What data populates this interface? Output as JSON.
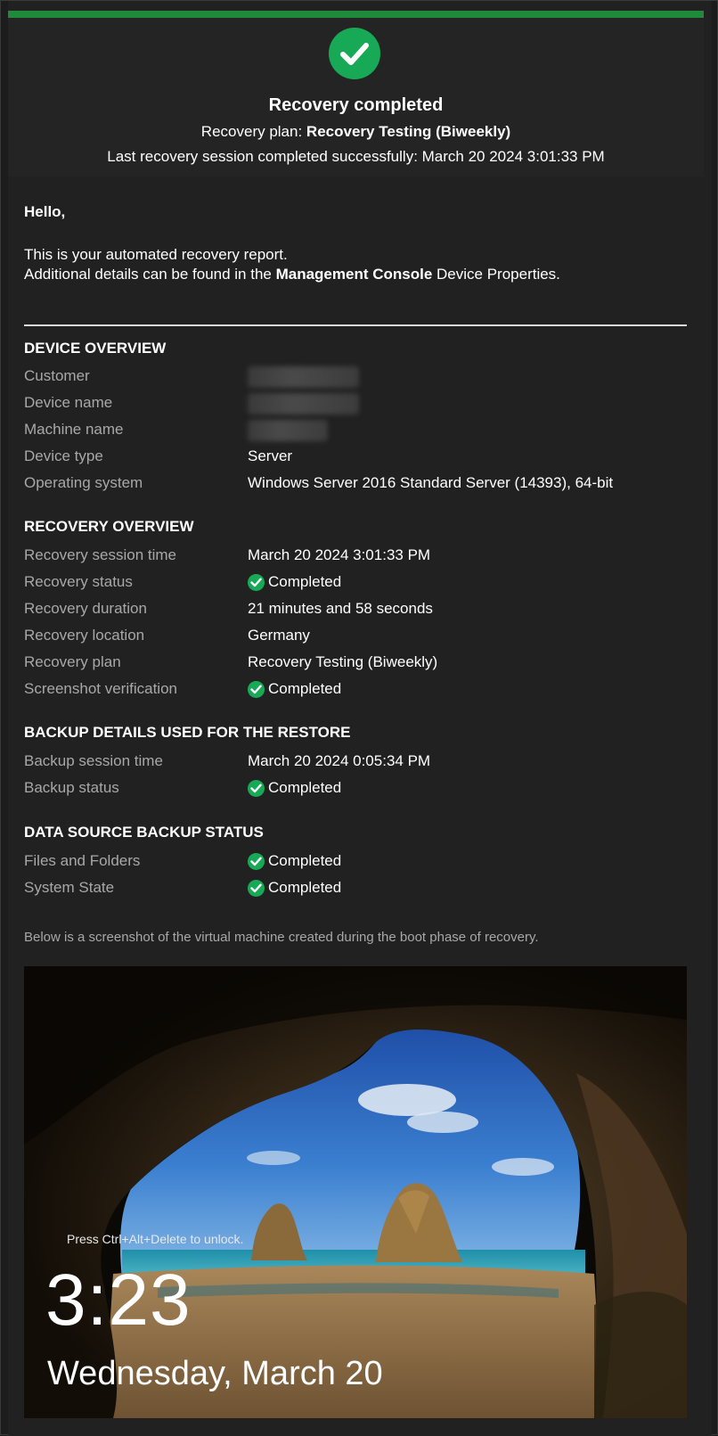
{
  "header": {
    "title": "Recovery completed",
    "plan_prefix": "Recovery plan: ",
    "plan_name": "Recovery Testing (Biweekly)",
    "last_session": "Last recovery session completed successfully: March 20 2024 3:01:33 PM"
  },
  "intro": {
    "greeting": "Hello,",
    "line1": "This is your automated recovery report.",
    "line2_prefix": "Additional details can be found in the ",
    "line2_bold": "Management Console",
    "line2_suffix": " Device Properties."
  },
  "device_overview": {
    "title": "DEVICE OVERVIEW",
    "customer_label": "Customer",
    "device_name_label": "Device name",
    "machine_name_label": "Machine name",
    "device_type_label": "Device type",
    "device_type_value": "Server",
    "os_label": "Operating system",
    "os_value": "Windows Server 2016 Standard Server (14393), 64-bit"
  },
  "recovery_overview": {
    "title": "RECOVERY OVERVIEW",
    "session_time_label": "Recovery session time",
    "session_time_value": "March 20 2024 3:01:33 PM",
    "status_label": "Recovery status",
    "status_value": "Completed",
    "duration_label": "Recovery duration",
    "duration_value": "21 minutes and 58 seconds",
    "location_label": "Recovery location",
    "location_value": "Germany",
    "plan_label": "Recovery plan",
    "plan_value": "Recovery Testing (Biweekly)",
    "screenshot_label": "Screenshot verification",
    "screenshot_value": "Completed"
  },
  "backup_details": {
    "title": "BACKUP DETAILS USED FOR THE RESTORE",
    "session_time_label": "Backup session time",
    "session_time_value": "March 20 2024 0:05:34 PM",
    "status_label": "Backup status",
    "status_value": "Completed"
  },
  "data_source": {
    "title": "DATA SOURCE BACKUP STATUS",
    "files_label": "Files and Folders",
    "files_value": "Completed",
    "system_label": "System State",
    "system_value": "Completed"
  },
  "screenshot": {
    "caption": "Below is a screenshot of the virtual machine created during the boot phase of recovery.",
    "unlock_text": "Press Ctrl+Alt+Delete to unlock.",
    "time": "3:23",
    "date": "Wednesday, March 20"
  },
  "colors": {
    "accent_green": "#1e8a3c",
    "check_green": "#18a957",
    "background": "#212121"
  }
}
